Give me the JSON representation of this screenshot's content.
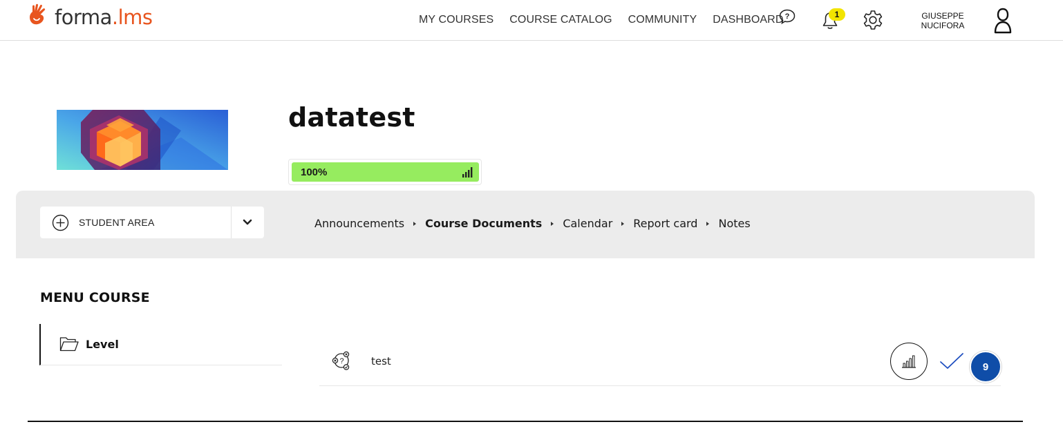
{
  "brand": {
    "name_part1": "forma",
    "name_dot": ".",
    "name_part2": "lms",
    "accent_color": "#e8551f"
  },
  "nav": {
    "items": [
      {
        "label": "MY COURSES"
      },
      {
        "label": "COURSE CATALOG"
      },
      {
        "label": "COMMUNITY"
      },
      {
        "label": "DASHBOARD"
      }
    ]
  },
  "header": {
    "help_icon": "help-question-icon",
    "notifications_icon": "bell-icon",
    "notifications_count": "1",
    "settings_icon": "gear-icon",
    "user_first_name": "GIUSEPPE",
    "user_last_name": "NUCIFORA",
    "user_icon": "user-icon"
  },
  "course": {
    "title": "datatest",
    "progress_percent": 100,
    "progress_label": "100%",
    "progress_color": "#96ec5f"
  },
  "area_select": {
    "label": "STUDENT AREA"
  },
  "breadcrumbs": [
    {
      "label": "Announcements",
      "active": false
    },
    {
      "label": "Course Documents",
      "active": true
    },
    {
      "label": "Calendar",
      "active": false
    },
    {
      "label": "Report card",
      "active": false
    },
    {
      "label": "Notes",
      "active": false
    }
  ],
  "menu": {
    "title": "MENU COURSE",
    "items": [
      {
        "label": "Level",
        "icon": "folder-open-icon"
      }
    ]
  },
  "content": {
    "items": [
      {
        "name": "test",
        "icon": "quiz-icon",
        "status": "completed",
        "count": "9"
      }
    ],
    "count_badge_color": "#0f4da8"
  }
}
